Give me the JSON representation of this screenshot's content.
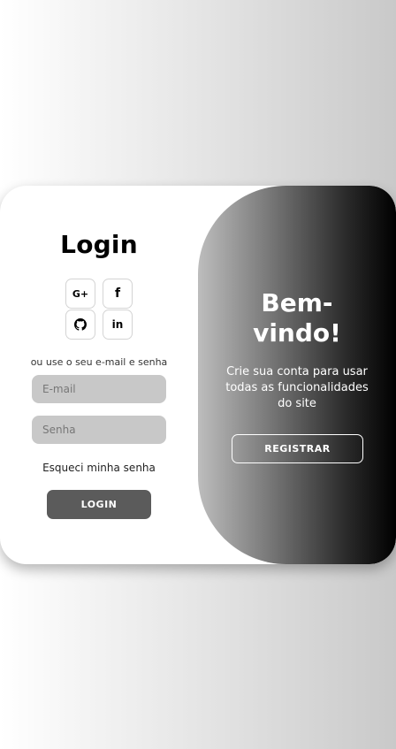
{
  "login": {
    "title": "Login",
    "social": [
      {
        "icon": "google-plus-icon",
        "glyph": "G+"
      },
      {
        "icon": "facebook-icon",
        "glyph": "f"
      },
      {
        "icon": "github-icon",
        "glyph": ""
      },
      {
        "icon": "linkedin-icon",
        "glyph": "in"
      }
    ],
    "hint": "ou use o seu e-mail e senha",
    "email_placeholder": "E-mail",
    "password_placeholder": "Senha",
    "forgot": "Esqueci minha senha",
    "button": "LOGIN"
  },
  "signup_panel": {
    "title": "Bem-vindo!",
    "text": "Crie sua conta para usar todas as funcionalidades do site",
    "button": "REGISTRAR"
  },
  "colors": {
    "input_bg": "#c8c8c8",
    "login_button_bg": "#5b5b5b",
    "panel_gradient_start": "#bdbdbd",
    "panel_gradient_end": "#000000"
  }
}
